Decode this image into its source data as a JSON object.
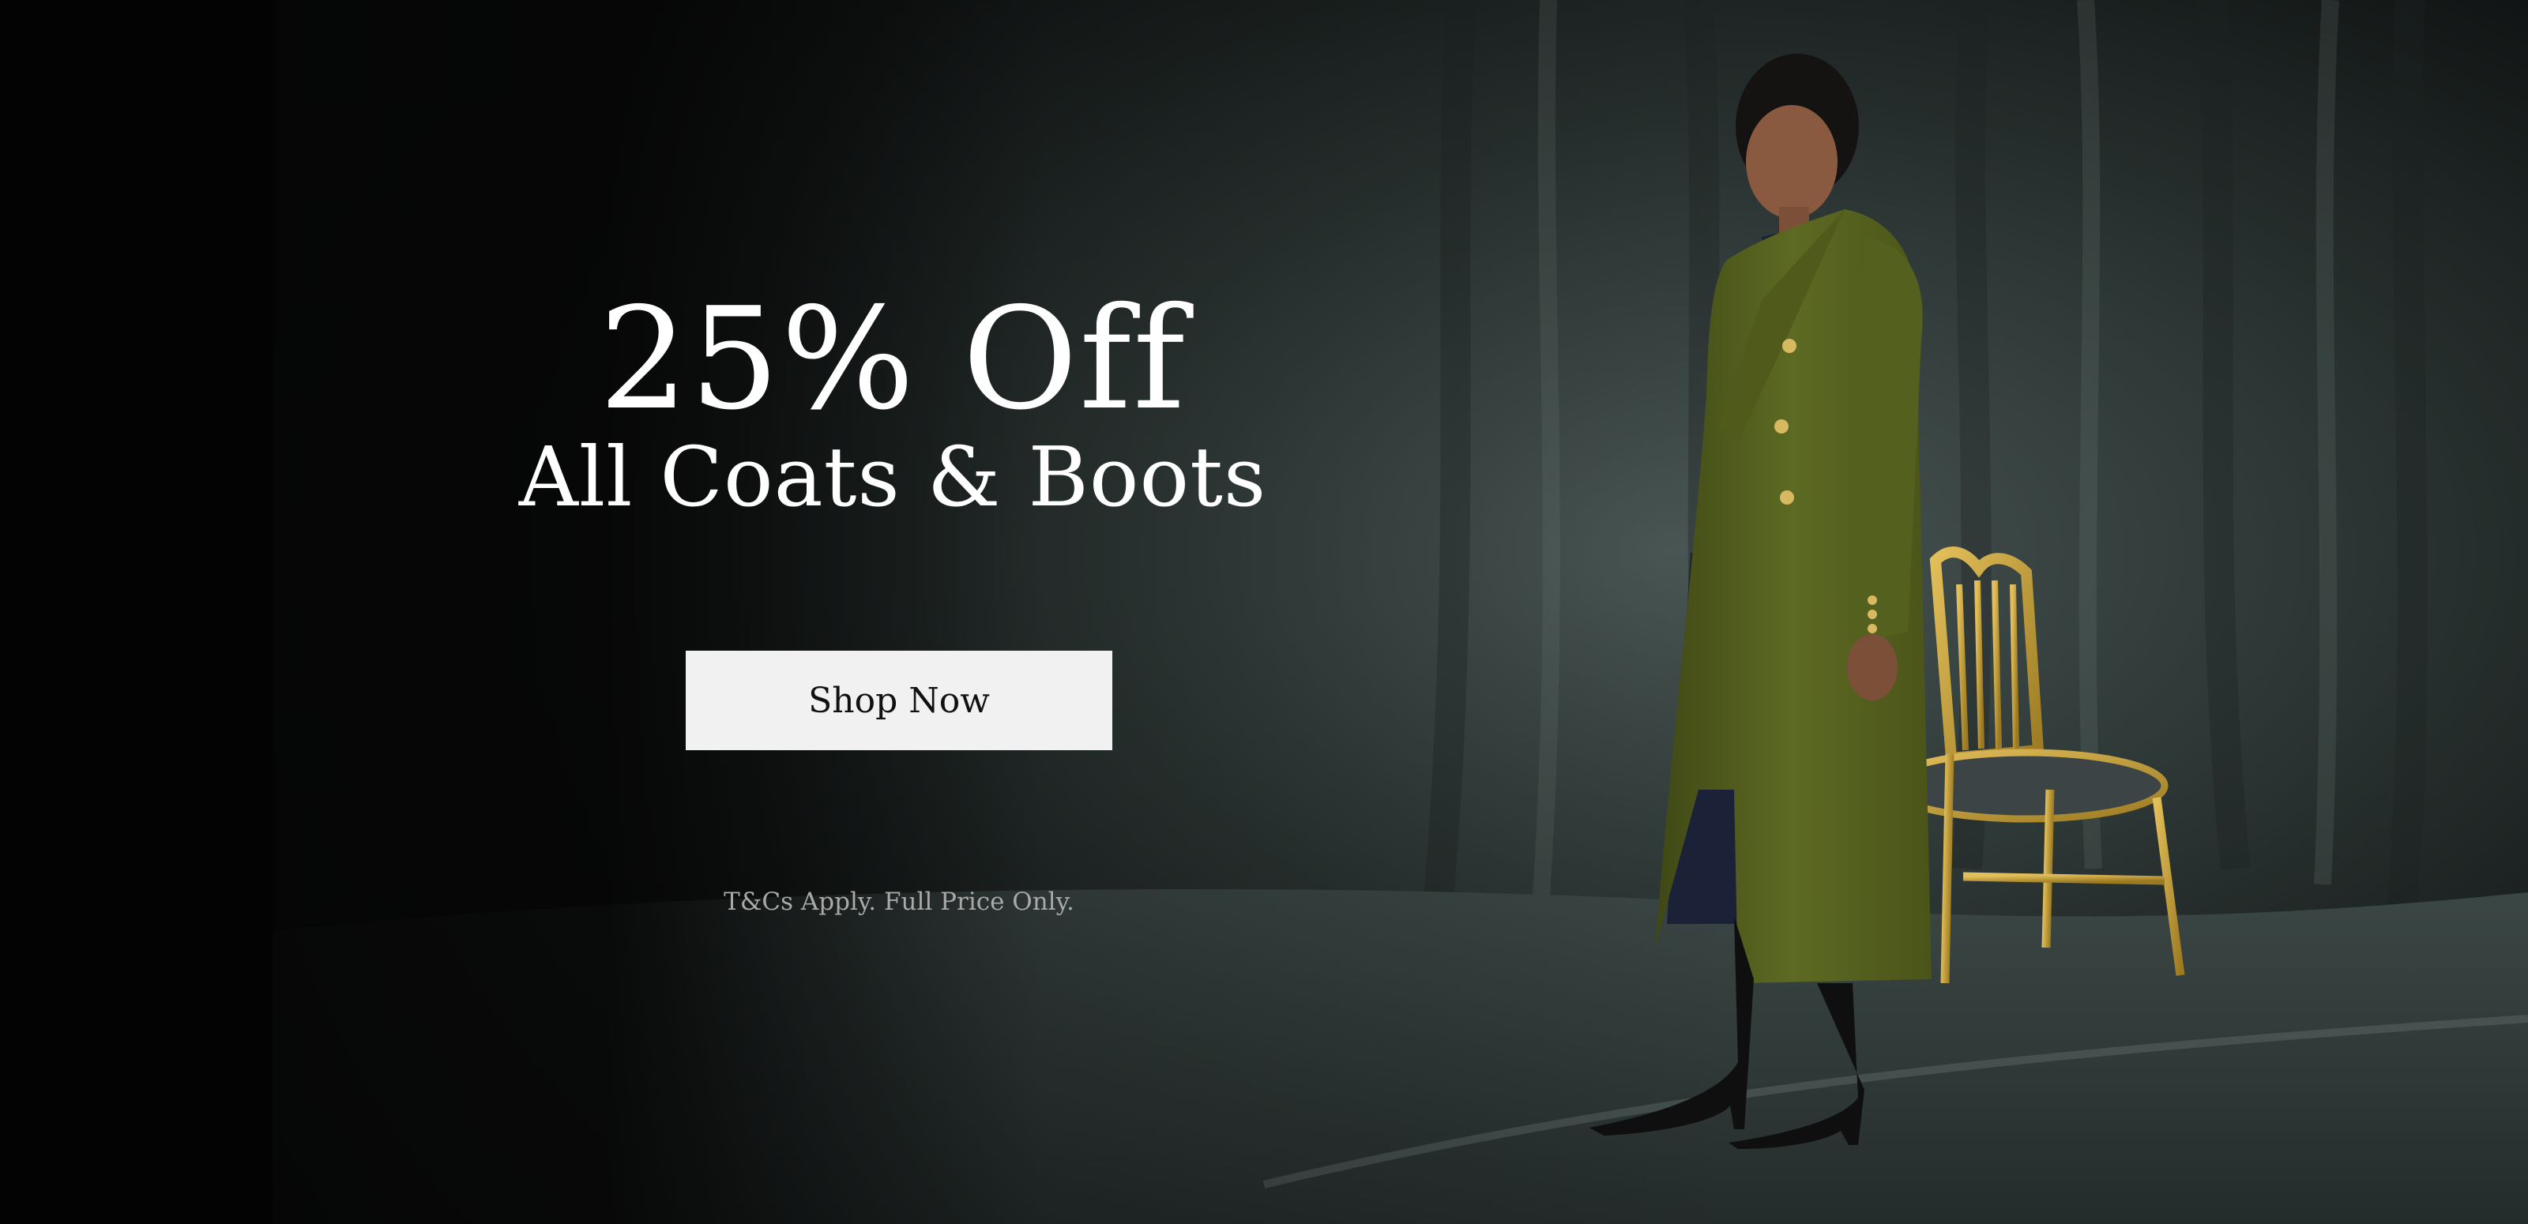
{
  "promo": {
    "headline": "25% Off",
    "subheadline": "All Coats & Boots",
    "cta_label": "Shop Now",
    "terms": "T&Cs Apply. Full Price Only."
  },
  "colors": {
    "background": "#050505",
    "backdrop": "#3a4644",
    "coat": "#59651f",
    "chair_gold": "#c9a13a",
    "button_bg": "#f1f1f1",
    "button_text": "#111111",
    "terms_text": "#a9a9a9"
  },
  "image": {
    "subject": "model-in-olive-coat",
    "props": [
      "gilt-chair",
      "draped-backdrop"
    ]
  }
}
